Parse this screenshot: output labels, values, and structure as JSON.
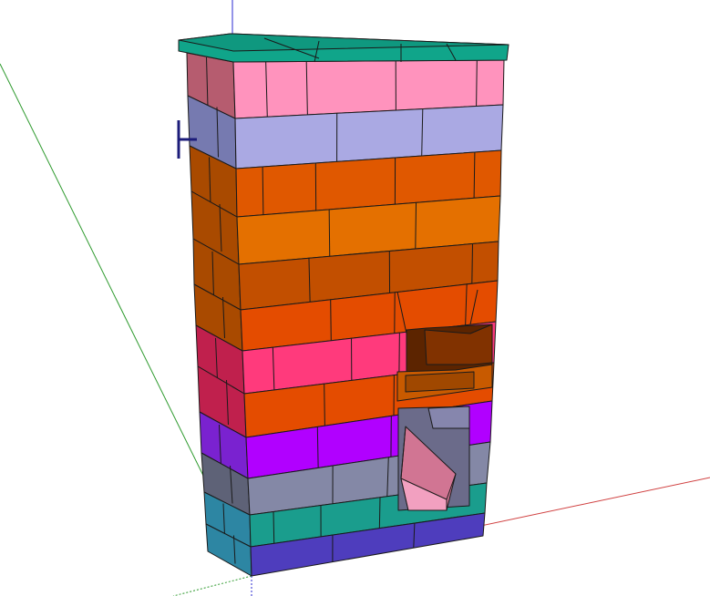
{
  "viewport": {
    "background_color": "#ffffff"
  },
  "axes": {
    "x_color": "#d04040",
    "y_color": "#2e9a2e",
    "z_color": "#2a2ad0"
  },
  "model": {
    "mortar_line_color": "#1a1a1a",
    "top_slab_color": "#10a58a",
    "row_colors": [
      {
        "name": "pink-course",
        "color": "#ff93bd"
      },
      {
        "name": "lavender-course",
        "color": "#aaa9e3"
      },
      {
        "name": "dark-orange-course",
        "color": "#e05800"
      },
      {
        "name": "orange-course",
        "color": "#e47000"
      },
      {
        "name": "brown-orange-course",
        "color": "#c24f00"
      },
      {
        "name": "red-orange-course",
        "color": "#e44c00"
      },
      {
        "name": "hot-pink-course",
        "color": "#ff3a7c"
      },
      {
        "name": "orange-course-2",
        "color": "#e44c00"
      },
      {
        "name": "purple-course",
        "color": "#b100ff"
      },
      {
        "name": "slate-course",
        "color": "#8488a6"
      },
      {
        "name": "teal-brown-course",
        "color": "#1a9d8d"
      },
      {
        "name": "blue-base-course",
        "color": "#4e3dbd"
      }
    ],
    "side_colors": {
      "pink": "#b65c6f",
      "lavender": "#767ab0",
      "orange": "#a94a00",
      "red": "#c0204d",
      "purple": "#7a22d0",
      "slate": "#5e6277",
      "teal": "#2d86a3",
      "blue": "#3b2da0"
    },
    "opening_colors": {
      "upper_interior": "#5c2400",
      "upper_floor": "#c85a00",
      "lower_interior": "#6b6b8a",
      "lower_shape": "#d17593",
      "lower_shape_light": "#f2a0c0"
    }
  }
}
